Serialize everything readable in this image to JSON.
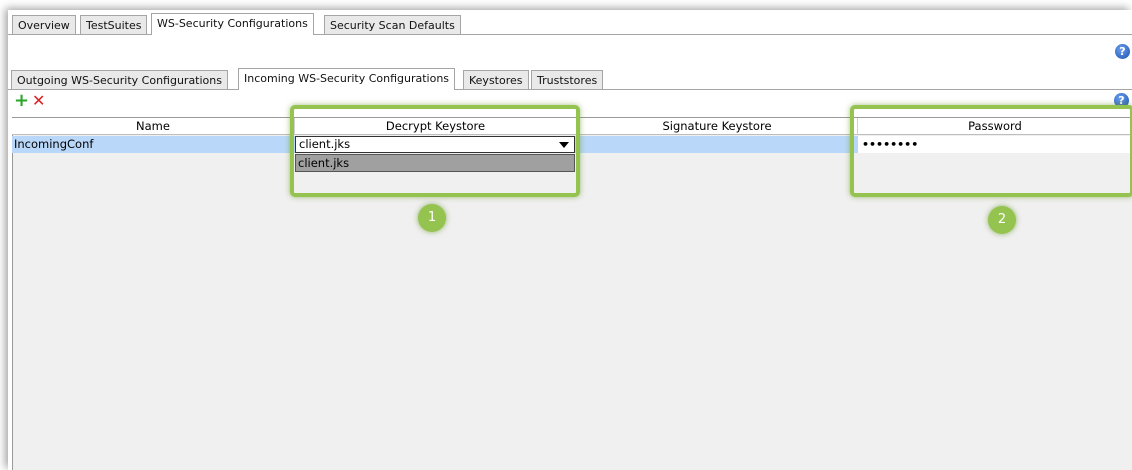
{
  "top_tabs": [
    "Overview",
    "TestSuites",
    "WS-Security Configurations",
    "Security Scan Defaults"
  ],
  "sub_tabs": [
    "Outgoing WS-Security Configurations",
    "Incoming WS-Security Configurations",
    "Keystores",
    "Truststores"
  ],
  "toolbar": {
    "add_symbol": "+",
    "remove_symbol": "✕",
    "help_symbol": "?"
  },
  "table": {
    "columns": [
      "Name",
      "Decrypt Keystore",
      "Signature Keystore",
      "Password"
    ],
    "row": {
      "name": "IncomingConf",
      "decrypt_keystore": "client.jks",
      "signature_keystore": "",
      "password": "••••••••"
    }
  },
  "dropdown": {
    "options": [
      "client.jks"
    ]
  },
  "markers": [
    "1",
    "2"
  ],
  "colors": {
    "highlight": "#95c34f",
    "selected_row": "#b9d7f8",
    "help": "#1c4fb0"
  }
}
